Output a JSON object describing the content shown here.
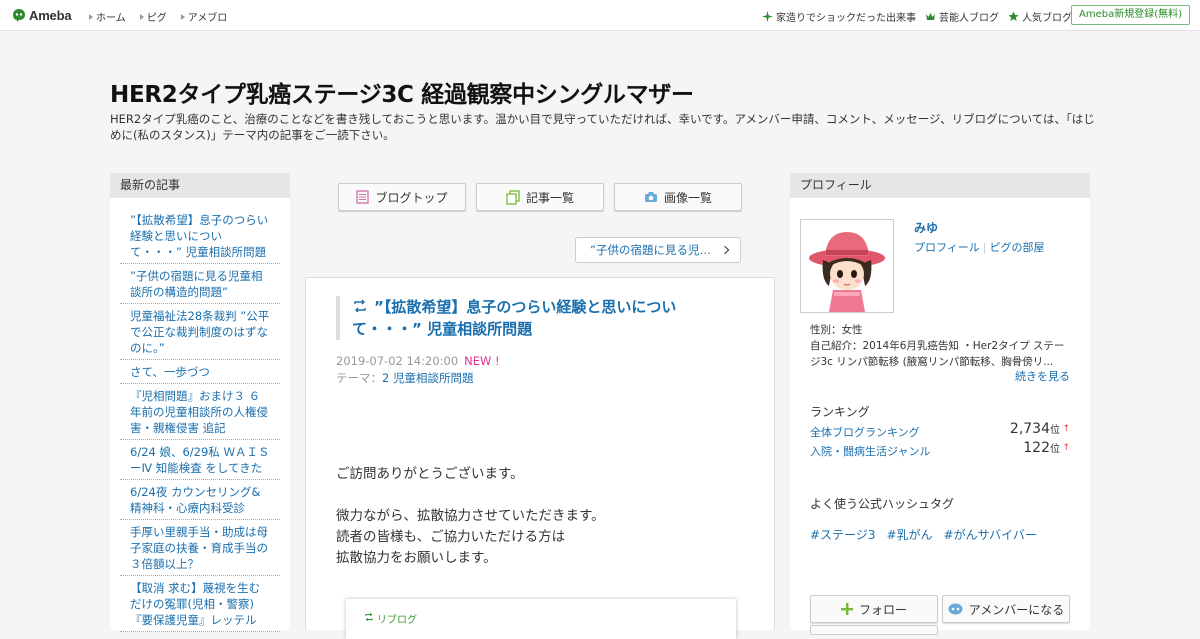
{
  "topbar": {
    "logo_text": "Ameba",
    "nav": [
      "ホーム",
      "ピグ",
      "アメブロ"
    ],
    "right": [
      {
        "icon": "sparkle-icon",
        "label": "家造りでショックだった出来事"
      },
      {
        "icon": "crown-icon",
        "label": "芸能人ブログ"
      },
      {
        "icon": "star-icon",
        "label": "人気ブログ"
      }
    ],
    "register_label": "Ameba新規登録(無料)"
  },
  "blog": {
    "title": "HER2タイプ乳癌ステージ3C 経過観察中シングルマザー",
    "description": "HER2タイプ乳癌のこと、治療のことなどを書き残しておこうと思います。温かい目で見守っていただければ、幸いです。アメンバー申請、コメント、メッセージ、リブログについては、「はじめに(私のスタンス)」テーマ内の記事をご一読下さい。"
  },
  "left": {
    "header": "最新の記事",
    "items": [
      "”【拡散希望】息子のつらい経験と思いについて・・・” 児童相談所問題",
      "”子供の宿題に見る児童相談所の構造的問題”",
      "児童福祉法28条裁判 ”公平で公正な裁判制度のはずなのに。”",
      "さて、一歩づつ",
      "『児相問題』おまけ３ ６年前の児童相談所の人権侵害・親権侵害 追記",
      "6/24 娘、6/29私 ＷＡＩＳーⅣ 知能検査 をしてきた",
      "6/24夜 カウンセリング&精神科・心療内科受診",
      "手厚い里親手当・助成は母子家庭の扶養・育成手当の３倍額以上？",
      "【取消 求む】蔑視を生むだけの冤罪(児相・警察)『要保護児童』レッテル"
    ]
  },
  "center": {
    "buttons": [
      {
        "icon": "blog-top-icon",
        "label": "ブログトップ"
      },
      {
        "icon": "article-list-icon",
        "label": "記事一覧"
      },
      {
        "icon": "camera-icon",
        "label": "画像一覧"
      }
    ],
    "next_label": "”子供の宿題に見る児…",
    "article": {
      "title": "”【拡散希望】息子のつらい経験と思いについて・・・” 児童相談所問題",
      "date": "2019-07-02 14:20:00",
      "new_badge": "NEW !",
      "theme_prefix": "テーマ：",
      "theme": "2 児童相談所問題",
      "body": [
        "ご訪問ありがとうございます。",
        "",
        "微力ながら、拡散協力させていただきます。",
        "読者の皆様も、ご協力いただける方は",
        "拡散協力をお願いします。"
      ],
      "reblog_label": "リブログ"
    }
  },
  "right": {
    "header": "プロフィール",
    "name": "みゆ",
    "profile_link": "プロフィール",
    "pig_link": "ピグの部屋",
    "gender": "性別：女性",
    "intro": "自己紹介：2014年6月乳癌告知 ・Her2タイプ ステージ3c リンパ節転移 (腋窩リンパ節転移、胸骨傍リ...",
    "more": "続きを見る",
    "ranking_header": "ランキング",
    "rankings": [
      {
        "label": "全体ブログランキング",
        "value": "2,734",
        "unit": "位",
        "arrow": "↑"
      },
      {
        "label": "入院・闘病生活ジャンル",
        "value": "122",
        "unit": "位",
        "arrow": "↑"
      }
    ],
    "hashtag_header": "よく使う公式ハッシュタグ",
    "hashtags": [
      "#ステージ3",
      "#乳がん",
      "#がんサバイバー"
    ],
    "follow_label": "フォロー",
    "amember_label": "アメンバーになる"
  },
  "colors": {
    "link": "#1a6fae",
    "new": "#e0338c",
    "ameba_green": "#2a8a2a"
  }
}
